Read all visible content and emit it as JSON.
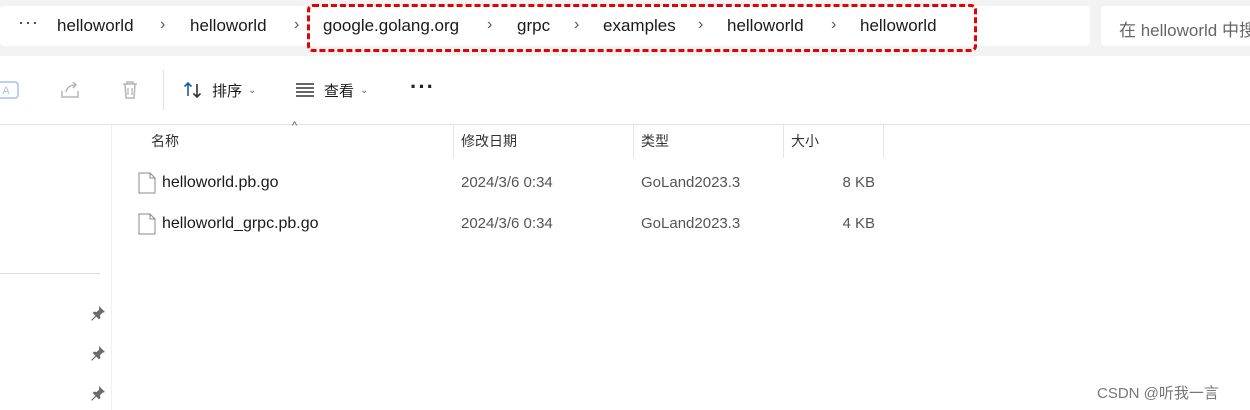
{
  "address_bar": {
    "more": "···",
    "crumbs": [
      "helloworld",
      "helloworld",
      "google.golang.org",
      "grpc",
      "examples",
      "helloworld",
      "helloworld"
    ],
    "separator": "›"
  },
  "search": {
    "placeholder": "在 helloworld 中搜"
  },
  "toolbar": {
    "icons": [
      "rename-icon",
      "share-icon",
      "delete-icon"
    ],
    "sort_label": "排序",
    "view_label": "查看",
    "more_label": "···",
    "caret": "⌄"
  },
  "columns": {
    "name": "名称",
    "modified": "修改日期",
    "type": "类型",
    "size": "大小",
    "sort_caret": "^"
  },
  "files": [
    {
      "name": "helloworld.pb.go",
      "modified": "2024/3/6 0:34",
      "type": "GoLand2023.3",
      "size": "8 KB"
    },
    {
      "name": "helloworld_grpc.pb.go",
      "modified": "2024/3/6 0:34",
      "type": "GoLand2023.3",
      "size": "4 KB"
    }
  ],
  "watermark": "CSDN @听我一言",
  "colors": {
    "highlight": "#e60000",
    "accent": "#0067c0"
  }
}
